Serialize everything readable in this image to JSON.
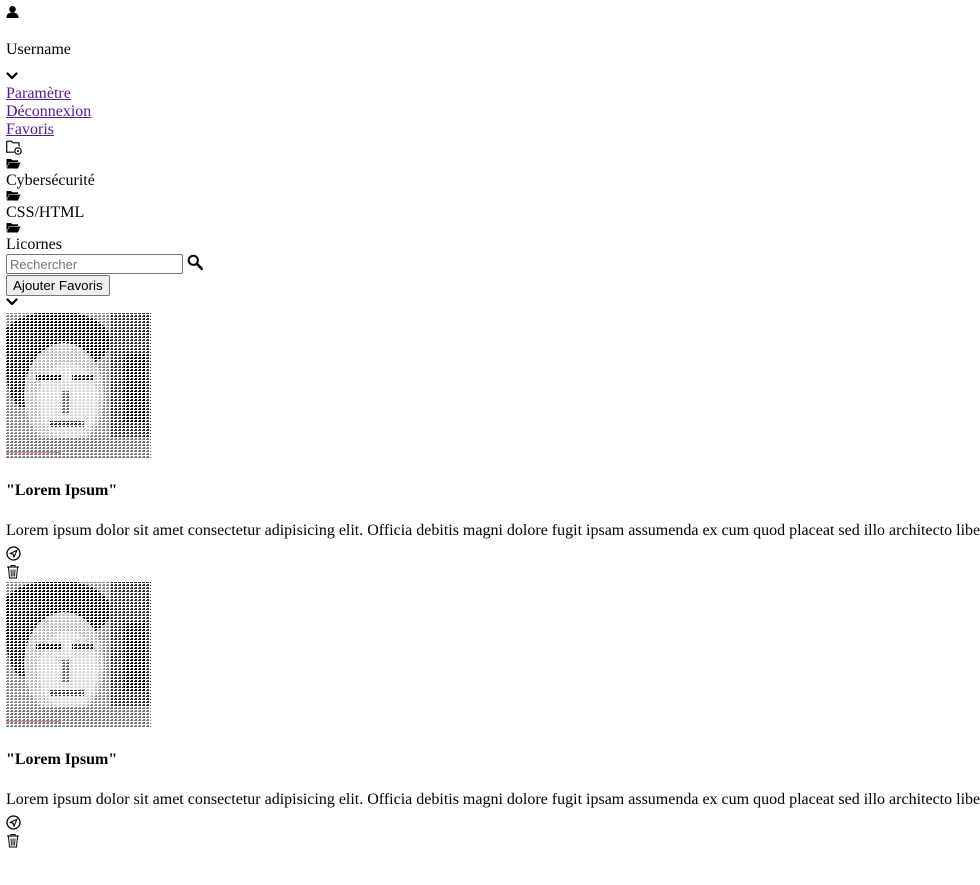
{
  "user": {
    "avatar_icon": "user-icon",
    "username": "Username",
    "dropdown_icon": "chevron-down-icon"
  },
  "menu": {
    "items": [
      {
        "label": "Paramètre"
      },
      {
        "label": "Déconnexion"
      },
      {
        "label": "Favoris"
      }
    ]
  },
  "folders": {
    "new_folder_icon": "folder-settings-icon",
    "items": [
      {
        "icon": "folder-open-icon",
        "label": "Cybersécurité"
      },
      {
        "icon": "folder-open-icon",
        "label": "CSS/HTML"
      },
      {
        "icon": "folder-open-icon",
        "label": "Licornes"
      }
    ]
  },
  "search": {
    "placeholder": "Rechercher",
    "value": "",
    "icon": "search-icon"
  },
  "favorites": {
    "add_label": "Ajouter Favoris",
    "toggle_icon": "chevron-down-icon"
  },
  "cards": [
    {
      "image": "portrait-image",
      "title": "\"Lorem Ipsum\"",
      "text": "Lorem ipsum dolor sit amet consectetur adipisicing elit. Officia debitis magni dolore fugit ipsam assumenda ex cum quod placeat sed illo architecto libe",
      "send_icon": "send-icon",
      "delete_icon": "trash-icon"
    },
    {
      "image": "portrait-image",
      "title": "\"Lorem Ipsum\"",
      "text": "Lorem ipsum dolor sit amet consectetur adipisicing elit. Officia debitis magni dolore fugit ipsam assumenda ex cum quod placeat sed illo architecto libe",
      "send_icon": "send-icon",
      "delete_icon": "trash-icon"
    }
  ]
}
